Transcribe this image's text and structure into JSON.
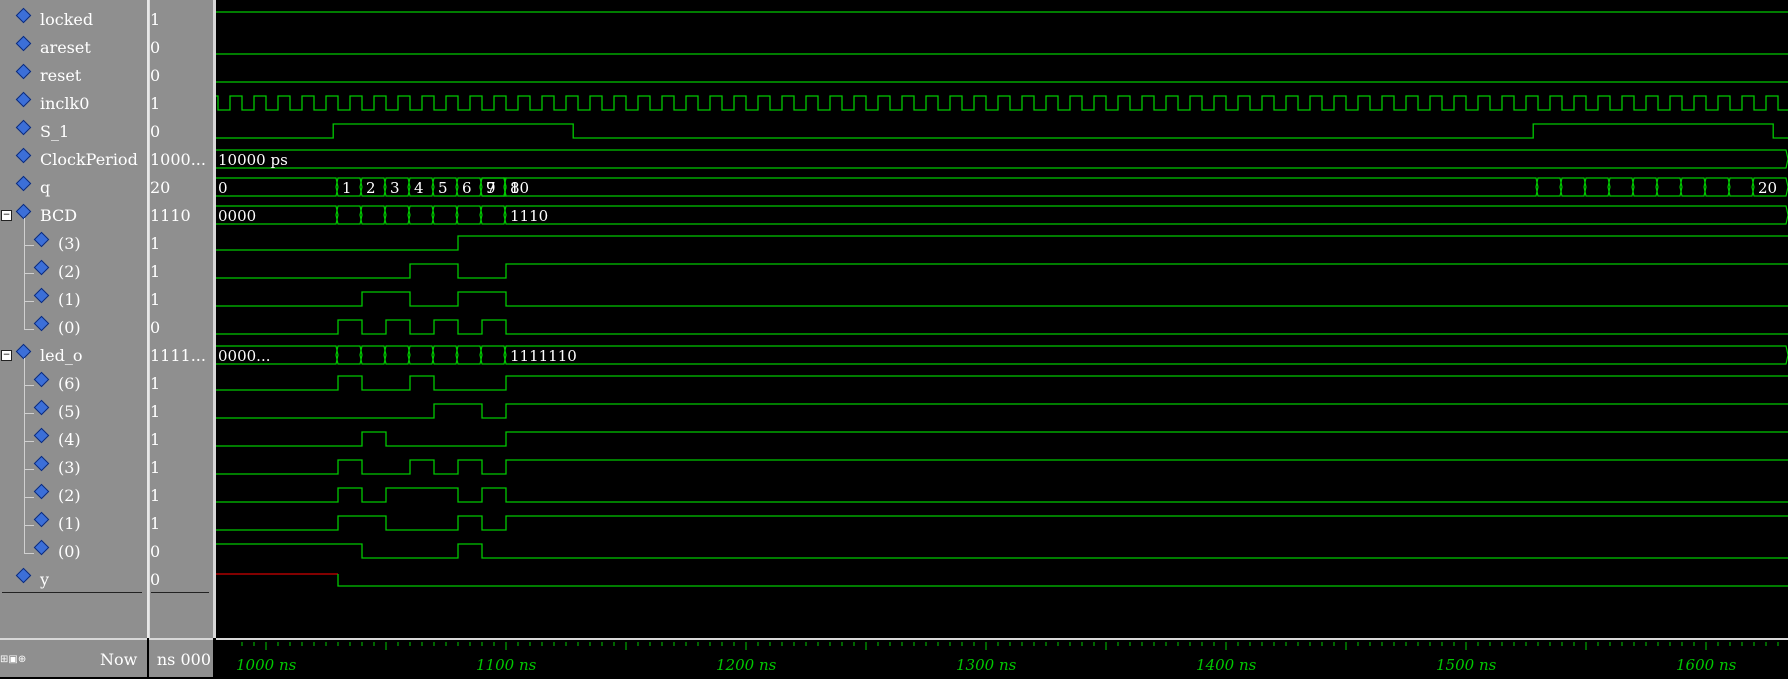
{
  "signals": [
    {
      "name": "locked",
      "value": "1",
      "indent": 0
    },
    {
      "name": "areset",
      "value": "0",
      "indent": 0
    },
    {
      "name": "reset",
      "value": "0",
      "indent": 0
    },
    {
      "name": "inclk0",
      "value": "1",
      "indent": 0
    },
    {
      "name": "S_1",
      "value": "0",
      "indent": 0
    },
    {
      "name": "ClockPeriod",
      "value": "1000...",
      "indent": 0
    },
    {
      "name": "q",
      "value": "20",
      "indent": 0
    },
    {
      "name": "BCD",
      "value": "1110",
      "indent": 0,
      "expandable": true
    },
    {
      "name": "(3)",
      "value": "1",
      "indent": 1
    },
    {
      "name": "(2)",
      "value": "1",
      "indent": 1
    },
    {
      "name": "(1)",
      "value": "1",
      "indent": 1
    },
    {
      "name": "(0)",
      "value": "0",
      "indent": 1
    },
    {
      "name": "led_o",
      "value": "1111...",
      "indent": 0,
      "expandable": true
    },
    {
      "name": "(6)",
      "value": "1",
      "indent": 1
    },
    {
      "name": "(5)",
      "value": "1",
      "indent": 1
    },
    {
      "name": "(4)",
      "value": "1",
      "indent": 1
    },
    {
      "name": "(3)",
      "value": "1",
      "indent": 1
    },
    {
      "name": "(2)",
      "value": "1",
      "indent": 1
    },
    {
      "name": "(1)",
      "value": "1",
      "indent": 1
    },
    {
      "name": "(0)",
      "value": "0",
      "indent": 1
    },
    {
      "name": "y",
      "value": "0",
      "indent": 0
    }
  ],
  "bus_labels": {
    "clockperiod": "10000 ps",
    "q_values": [
      "0",
      "1",
      "2",
      "3",
      "4",
      "5",
      "6",
      "7",
      "8",
      "9",
      "10",
      "20"
    ],
    "bcd_start": "0000",
    "bcd_end": "1110",
    "led_start": "0000...",
    "led_end": "1111110"
  },
  "footer": {
    "now_label": "Now",
    "now_value": "000 ns"
  },
  "timeline": {
    "unit": "ns",
    "ticks": [
      "1000 ns",
      "1100 ns",
      "1200 ns",
      "1300 ns",
      "1400 ns",
      "1500 ns",
      "1600 ns"
    ]
  },
  "colors": {
    "wave": "#00c800",
    "undefined": "#d00000",
    "panel": "#8f8f8f",
    "background": "#000000",
    "diamond": "#3c6fd8"
  }
}
